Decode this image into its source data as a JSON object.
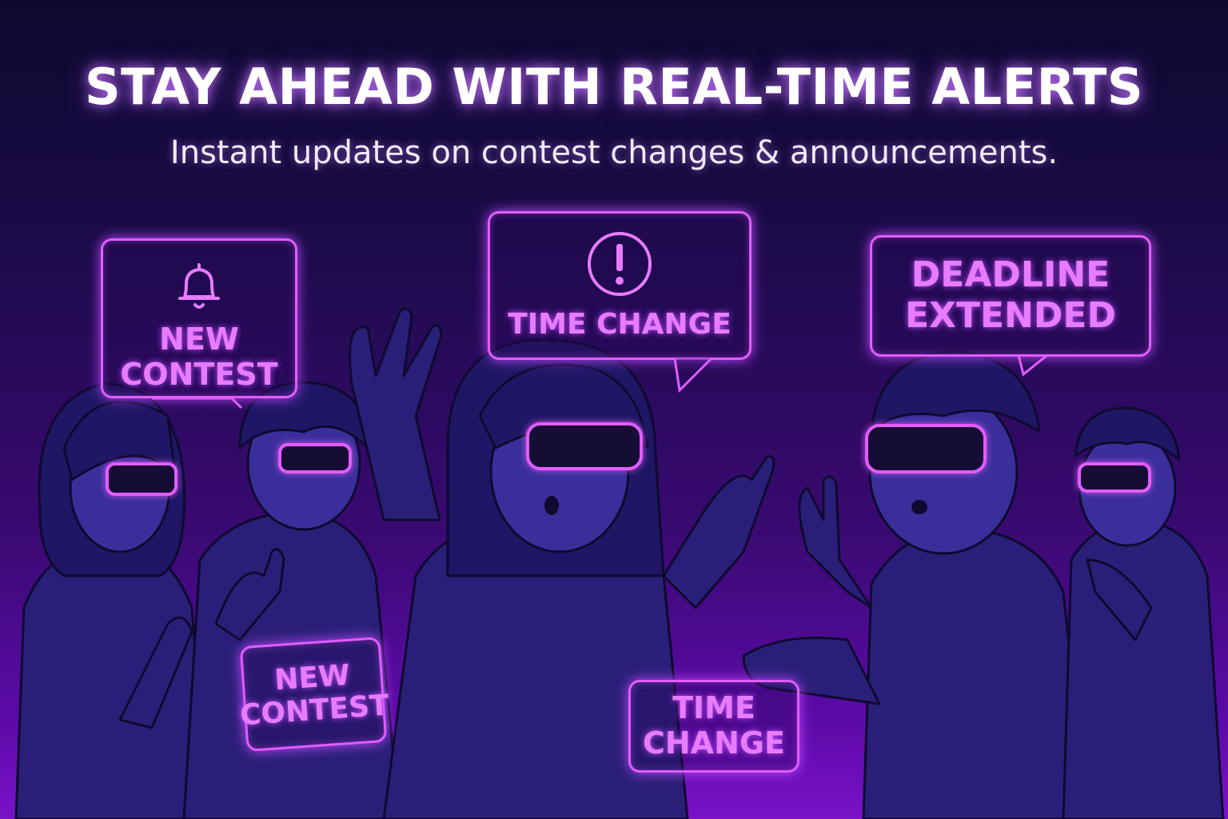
{
  "header": {
    "title": "STAY AHEAD WITH REAL-TIME ALERTS",
    "subtitle": "Instant updates on contest changes & announcements."
  },
  "alerts": [
    {
      "text": "NEW\nCONTEST",
      "icon": "bell-icon"
    },
    {
      "text": "TIME CHANGE",
      "icon": "exclamation-icon"
    },
    {
      "text": "DEADLINE\nEXTENDED",
      "icon": ""
    },
    {
      "text": "NEW\nCONTEST",
      "icon": ""
    },
    {
      "text": "TIME\nCHANGE",
      "icon": ""
    }
  ],
  "colors": {
    "neon": "#e25cff",
    "neon_text": "#e77cff",
    "bg_top": "#0d0a2e",
    "bg_bottom": "#7a12c8",
    "figure_fill": "#2a1f78",
    "figure_line": "#0e0a30"
  }
}
